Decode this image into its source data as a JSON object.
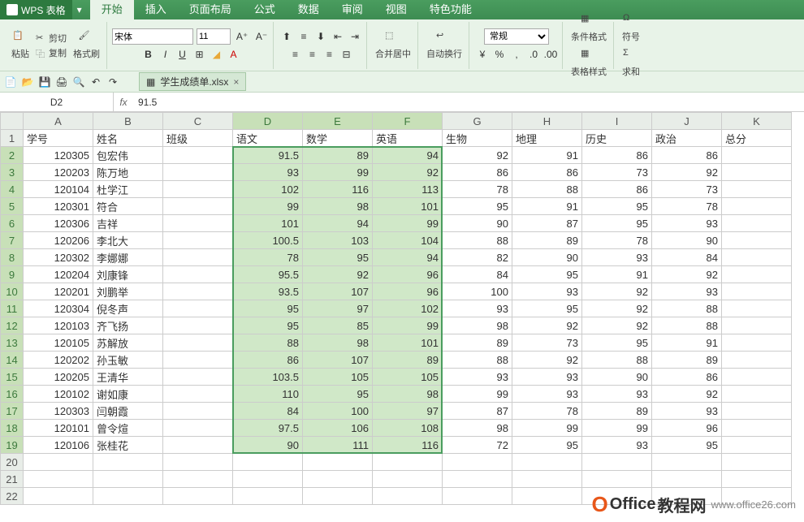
{
  "app": {
    "name": "WPS 表格"
  },
  "menu": {
    "tabs": [
      "开始",
      "插入",
      "页面布局",
      "公式",
      "数据",
      "审阅",
      "视图",
      "特色功能"
    ],
    "active": 0
  },
  "ribbon": {
    "paste": "粘贴",
    "cut": "剪切",
    "copy": "复制",
    "format_painter": "格式刷",
    "font_name": "宋体",
    "font_size": "11",
    "merge_center": "合并居中",
    "wrap": "自动换行",
    "number_format": "常规",
    "cond_format": "条件格式",
    "table_style": "表格样式",
    "symbol": "符号",
    "sum": "求和"
  },
  "file_tab": {
    "name": "学生成绩单.xlsx"
  },
  "name_box": "D2",
  "formula": "91.5",
  "columns": [
    "A",
    "B",
    "C",
    "D",
    "E",
    "F",
    "G",
    "H",
    "I",
    "J",
    "K"
  ],
  "headers": {
    "A": "学号",
    "B": "姓名",
    "C": "班级",
    "D": "语文",
    "E": "数学",
    "F": "英语",
    "G": "生物",
    "H": "地理",
    "I": "历史",
    "J": "政治",
    "K": "总分"
  },
  "rows": [
    {
      "A": 120305,
      "B": "包宏伟",
      "D": 91.5,
      "E": 89,
      "F": 94,
      "G": 92,
      "H": 91,
      "I": 86,
      "J": 86
    },
    {
      "A": 120203,
      "B": "陈万地",
      "D": 93,
      "E": 99,
      "F": 92,
      "G": 86,
      "H": 86,
      "I": 73,
      "J": 92
    },
    {
      "A": 120104,
      "B": "杜学江",
      "D": 102,
      "E": 116,
      "F": 113,
      "G": 78,
      "H": 88,
      "I": 86,
      "J": 73
    },
    {
      "A": 120301,
      "B": "符合",
      "D": 99,
      "E": 98,
      "F": 101,
      "G": 95,
      "H": 91,
      "I": 95,
      "J": 78
    },
    {
      "A": 120306,
      "B": "吉祥",
      "D": 101,
      "E": 94,
      "F": 99,
      "G": 90,
      "H": 87,
      "I": 95,
      "J": 93
    },
    {
      "A": 120206,
      "B": "李北大",
      "D": 100.5,
      "E": 103,
      "F": 104,
      "G": 88,
      "H": 89,
      "I": 78,
      "J": 90
    },
    {
      "A": 120302,
      "B": "李娜娜",
      "D": 78,
      "E": 95,
      "F": 94,
      "G": 82,
      "H": 90,
      "I": 93,
      "J": 84
    },
    {
      "A": 120204,
      "B": "刘康锋",
      "D": 95.5,
      "E": 92,
      "F": 96,
      "G": 84,
      "H": 95,
      "I": 91,
      "J": 92
    },
    {
      "A": 120201,
      "B": "刘鹏举",
      "D": 93.5,
      "E": 107,
      "F": 96,
      "G": 100,
      "H": 93,
      "I": 92,
      "J": 93
    },
    {
      "A": 120304,
      "B": "倪冬声",
      "D": 95,
      "E": 97,
      "F": 102,
      "G": 93,
      "H": 95,
      "I": 92,
      "J": 88
    },
    {
      "A": 120103,
      "B": "齐飞扬",
      "D": 95,
      "E": 85,
      "F": 99,
      "G": 98,
      "H": 92,
      "I": 92,
      "J": 88
    },
    {
      "A": 120105,
      "B": "苏解放",
      "D": 88,
      "E": 98,
      "F": 101,
      "G": 89,
      "H": 73,
      "I": 95,
      "J": 91
    },
    {
      "A": 120202,
      "B": "孙玉敏",
      "D": 86,
      "E": 107,
      "F": 89,
      "G": 88,
      "H": 92,
      "I": 88,
      "J": 89
    },
    {
      "A": 120205,
      "B": "王清华",
      "D": 103.5,
      "E": 105,
      "F": 105,
      "G": 93,
      "H": 93,
      "I": 90,
      "J": 86
    },
    {
      "A": 120102,
      "B": "谢如康",
      "D": 110,
      "E": 95,
      "F": 98,
      "G": 99,
      "H": 93,
      "I": 93,
      "J": 92
    },
    {
      "A": 120303,
      "B": "闫朝霞",
      "D": 84,
      "E": 100,
      "F": 97,
      "G": 87,
      "H": 78,
      "I": 89,
      "J": 93
    },
    {
      "A": 120101,
      "B": "曾令煊",
      "D": 97.5,
      "E": 106,
      "F": 108,
      "G": 98,
      "H": 99,
      "I": 99,
      "J": 96
    },
    {
      "A": 120106,
      "B": "张桂花",
      "D": 90,
      "E": 111,
      "F": 116,
      "G": 72,
      "H": 95,
      "I": 93,
      "J": 95
    }
  ],
  "watermark": {
    "brand": "Office",
    "suffix": "教程网",
    "url": "www.office26.com"
  }
}
